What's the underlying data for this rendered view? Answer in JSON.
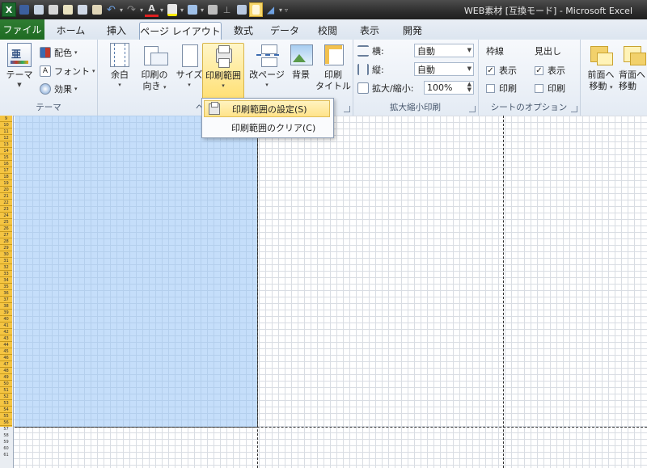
{
  "window": {
    "title": "WEB素材 [互換モード] - Microsoft Excel"
  },
  "qat": {
    "app_icon": "X"
  },
  "tabs": [
    "ファイル",
    "ホーム",
    "挿入",
    "ページ レイアウト",
    "数式",
    "データ",
    "校閲",
    "表示",
    "開発"
  ],
  "ribbon": {
    "theme": {
      "themes_label": "テーマ",
      "colors_label": "配色",
      "fonts_label": "フォント",
      "effects_label": "効果",
      "group_label": "テーマ"
    },
    "page_setup": {
      "margins_label": "余白",
      "orientation_label1": "印刷の",
      "orientation_label2": "向き",
      "size_label": "サイズ",
      "print_area_label": "印刷範囲",
      "breaks_label": "改ページ",
      "background_label": "背景",
      "titles_label1": "印刷",
      "titles_label2": "タイトル",
      "group_label_partial": "ペ"
    },
    "scale": {
      "width_label": "横:",
      "width_value": "自動",
      "height_label": "縦:",
      "height_value": "自動",
      "scale_label": "拡大/縮小:",
      "scale_value": "100%",
      "group_label": "拡大縮小印刷"
    },
    "sheet_options": {
      "gridlines_label": "枠線",
      "headings_label": "見出し",
      "view_label": "表示",
      "print_label": "印刷",
      "gridlines_view": true,
      "gridlines_print": false,
      "headings_view": true,
      "headings_print": false,
      "group_label": "シートのオプション"
    },
    "arrange": {
      "bring_forward_1": "前面へ",
      "bring_forward_2": "移動",
      "send_backward_1": "背面へ",
      "send_backward_2": "移動"
    }
  },
  "dropdown": {
    "items": [
      "印刷範囲の設定(S)",
      "印刷範囲のクリア(C)"
    ]
  },
  "sheet": {
    "row_numbers": [
      "9",
      "10",
      "11",
      "12",
      "13",
      "14",
      "15",
      "16",
      "17",
      "18",
      "19",
      "20",
      "21",
      "22",
      "23",
      "24",
      "25",
      "26",
      "27",
      "28",
      "29",
      "30",
      "31",
      "32",
      "33",
      "34",
      "35",
      "36",
      "37",
      "38",
      "39",
      "40",
      "41",
      "42",
      "43",
      "44",
      "45",
      "46",
      "47",
      "48",
      "49",
      "50",
      "51",
      "52",
      "53",
      "54",
      "55",
      "56",
      "57",
      "58",
      "59",
      "60",
      "61"
    ]
  },
  "colors": {
    "file_tab": "#1e6a22",
    "highlight": "#ffe38a",
    "selection": "#96c3f5",
    "row_header_selected": "#f5c542"
  }
}
